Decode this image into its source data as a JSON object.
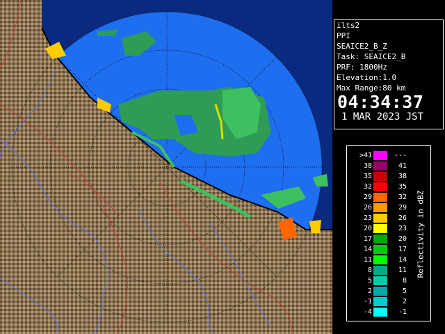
{
  "info": {
    "site": "ilts2",
    "mode": "PPI",
    "product": "SEAICE2_B_Z",
    "task": "Task: SEAICE2_B",
    "prf": "PRF: 1800Hz",
    "elevation": "Elevation:1.0",
    "max_range": "Max Range:80 km",
    "time": "04:34:37",
    "date": "1 MAR 2023 JST"
  },
  "legend": {
    "title": "Reflectivity in dBZ",
    "rows": [
      {
        "lo": ">41",
        "hi": "---",
        "color": "#ff00ff"
      },
      {
        "lo": "38",
        "hi": "41",
        "color": "#990066"
      },
      {
        "lo": "35",
        "hi": "38",
        "color": "#cc0000"
      },
      {
        "lo": "32",
        "hi": "35",
        "color": "#ff0000"
      },
      {
        "lo": "29",
        "hi": "32",
        "color": "#ff6600"
      },
      {
        "lo": "26",
        "hi": "29",
        "color": "#ff9900"
      },
      {
        "lo": "23",
        "hi": "26",
        "color": "#ffcc00"
      },
      {
        "lo": "20",
        "hi": "23",
        "color": "#ffff00"
      },
      {
        "lo": "17",
        "hi": "20",
        "color": "#00aa00"
      },
      {
        "lo": "14",
        "hi": "17",
        "color": "#00cc00"
      },
      {
        "lo": "11",
        "hi": "14",
        "color": "#00ff00"
      },
      {
        "lo": "8",
        "hi": "11",
        "color": "#00aa88"
      },
      {
        "lo": "5",
        "hi": "8",
        "color": "#00ccaa"
      },
      {
        "lo": "2",
        "hi": "5",
        "color": "#00aaaa"
      },
      {
        "lo": "-1",
        "hi": "2",
        "color": "#00cccc"
      },
      {
        "lo": "-4",
        "hi": "-1",
        "color": "#00ffff"
      }
    ]
  },
  "colors": {
    "sea": "#1e6ef0",
    "land": "#8a7050",
    "rings": "#000000",
    "rivers": "#6070e0",
    "borders": "#c04040"
  }
}
